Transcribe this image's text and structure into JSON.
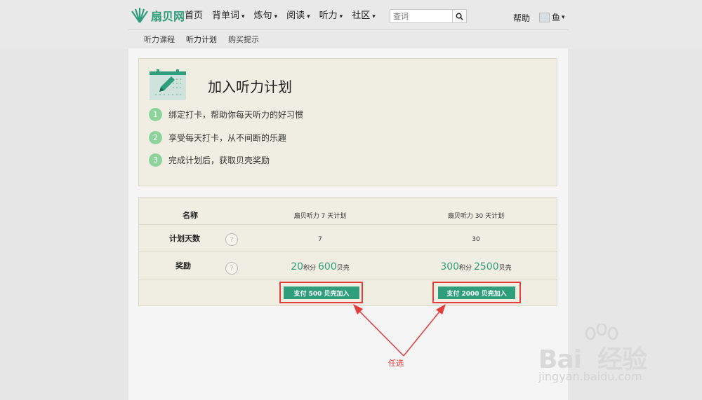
{
  "brand": {
    "logo_text": "扇贝网"
  },
  "nav": {
    "items": [
      {
        "label": "首页"
      },
      {
        "label": "背单词",
        "caret": "▾"
      },
      {
        "label": "炼句",
        "caret": "▾"
      },
      {
        "label": "阅读",
        "caret": "▾"
      },
      {
        "label": "听力",
        "caret": "▾"
      },
      {
        "label": "社区",
        "caret": "▾"
      }
    ],
    "search_placeholder": "查词",
    "help": "帮助",
    "user": "鱼",
    "user_caret": "▾"
  },
  "subnav": {
    "items": [
      {
        "label": "听力课程"
      },
      {
        "label": "听力计划"
      },
      {
        "label": "购买提示"
      }
    ],
    "active_index": 1
  },
  "plan": {
    "title": "加入听力计划",
    "steps": [
      {
        "num": "1",
        "text": "绑定打卡，帮助你每天听力的好习惯"
      },
      {
        "num": "2",
        "text": "享受每天打卡，从不间断的乐趣"
      },
      {
        "num": "3",
        "text": "完成计划后，获取贝壳奖励"
      }
    ]
  },
  "table": {
    "headers": {
      "name": "名称",
      "days": "计划天数",
      "reward": "奖励"
    },
    "help_icon": "?",
    "plans": [
      {
        "name": "扇贝听力 7 天计划",
        "days": "7",
        "reward_points": "20",
        "reward_points_unit": "积分",
        "reward_shells": "600",
        "reward_shells_unit": "贝壳",
        "button": "支付 500 贝壳加入"
      },
      {
        "name": "扇贝听力 30 天计划",
        "days": "30",
        "reward_points": "300",
        "reward_points_unit": "积分",
        "reward_shells": "2500",
        "reward_shells_unit": "贝壳",
        "button": "支付 2000 贝壳加入"
      }
    ]
  },
  "annotation": {
    "label": "任选",
    "color": "#e23a3a"
  },
  "watermark": {
    "brand": "Bai  经验",
    "url": "jingyan.baidu.com"
  },
  "colors": {
    "accent": "#2f9e7a",
    "step_badge": "#8dd39c",
    "panel": "#f0eee3"
  }
}
